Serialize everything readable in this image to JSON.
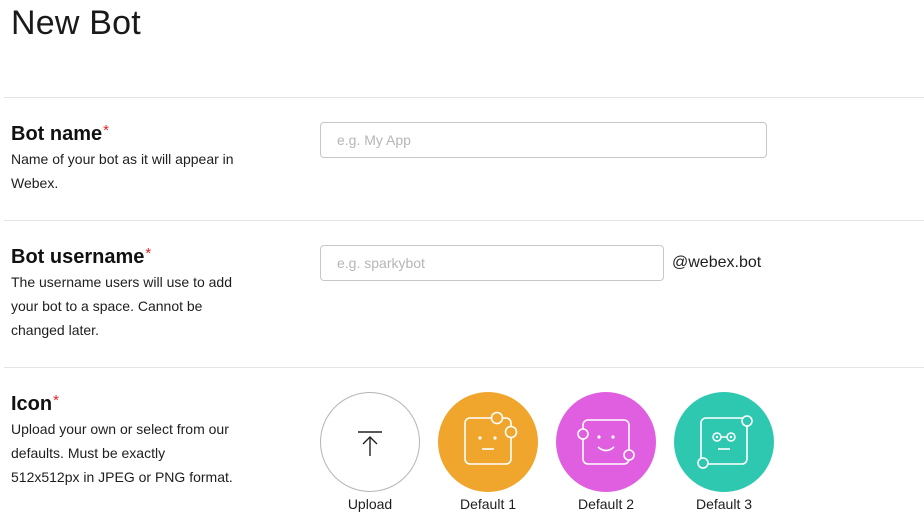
{
  "page": {
    "title": "New Bot"
  },
  "bot_name": {
    "label": "Bot name",
    "required_marker": "*",
    "description": "Name of your bot as it will appear in Webex.",
    "placeholder": "e.g. My App",
    "value": ""
  },
  "bot_username": {
    "label": "Bot username",
    "required_marker": "*",
    "description": "The username users will use to add your bot to a space. Cannot be changed later.",
    "placeholder": "e.g. sparkybot",
    "value": "",
    "suffix": "@webex.bot"
  },
  "icon": {
    "label": "Icon",
    "required_marker": "*",
    "description": "Upload your own or select from our defaults. Must be exactly 512x512px in JPEG or PNG format.",
    "options": [
      {
        "label": "Upload",
        "icon": "upload-arrow-icon"
      },
      {
        "label": "Default 1",
        "icon": "bot-face-icon",
        "color": "#f0a52d"
      },
      {
        "label": "Default 2",
        "icon": "bot-face-icon",
        "color": "#df5fe0"
      },
      {
        "label": "Default 3",
        "icon": "bot-face-icon",
        "color": "#2ec8b0"
      }
    ]
  }
}
